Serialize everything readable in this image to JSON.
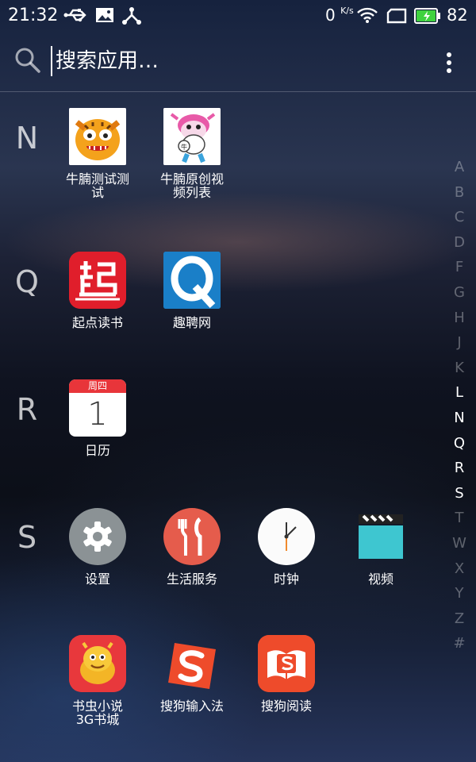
{
  "status_bar": {
    "time": "21:32",
    "net_speed": "0",
    "net_unit": "K/s",
    "battery": "82",
    "icons": [
      "usb-icon",
      "image-icon",
      "share-icon",
      "wifi-icon",
      "screen-icon",
      "battery-icon"
    ]
  },
  "search": {
    "placeholder": "搜索应用…"
  },
  "sections": [
    {
      "letter": "N",
      "apps": [
        {
          "label": "牛腩测试测\n试",
          "icon": "tiger-icon"
        },
        {
          "label": "牛腩原创视\n频列表",
          "icon": "cow-icon"
        }
      ]
    },
    {
      "letter": "Q",
      "apps": [
        {
          "label": "起点读书",
          "icon": "qidian-icon"
        },
        {
          "label": "趣聘网",
          "icon": "qupin-icon"
        }
      ]
    },
    {
      "letter": "R",
      "apps": [
        {
          "label": "日历",
          "icon": "calendar-icon",
          "header": "周四",
          "day": "1"
        }
      ]
    },
    {
      "letter": "S",
      "apps": [
        {
          "label": "设置",
          "icon": "settings-icon"
        },
        {
          "label": "生活服务",
          "icon": "life-service-icon"
        },
        {
          "label": "时钟",
          "icon": "clock-icon"
        },
        {
          "label": "视频",
          "icon": "video-icon"
        },
        {
          "label": "书虫小说\n3G书城",
          "icon": "bookworm-icon"
        },
        {
          "label": "搜狗输入法",
          "icon": "sogou-input-icon"
        },
        {
          "label": "搜狗阅读",
          "icon": "sogou-reader-icon"
        }
      ]
    }
  ],
  "alpha_index": [
    "A",
    "B",
    "C",
    "D",
    "F",
    "G",
    "H",
    "J",
    "K",
    "L",
    "N",
    "Q",
    "R",
    "S",
    "T",
    "W",
    "X",
    "Y",
    "Z",
    "#"
  ],
  "alpha_active": [
    "L",
    "N",
    "Q",
    "R",
    "S"
  ],
  "colors": {
    "qidian": "#e01e2b",
    "qupin": "#1a7fc8",
    "calendar_red": "#e8353a",
    "life_service": "#e55c4c",
    "video": "#3ec6d0",
    "bookworm": "#e8383c",
    "sogou": "#ee4b2b"
  }
}
